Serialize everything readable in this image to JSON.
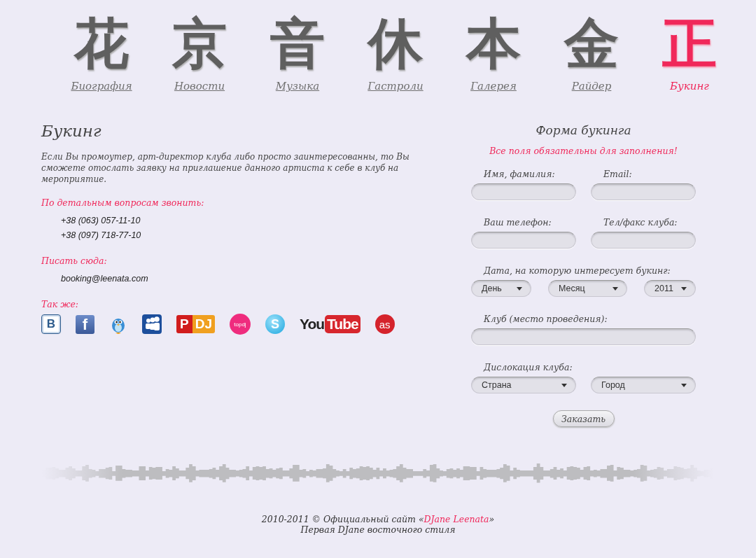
{
  "nav": [
    {
      "glyph": "花",
      "label": "Биография",
      "selected": false
    },
    {
      "glyph": "京",
      "label": "Новости",
      "selected": false
    },
    {
      "glyph": "音",
      "label": "Музыка",
      "selected": false
    },
    {
      "glyph": "休",
      "label": "Гастроли",
      "selected": false
    },
    {
      "glyph": "本",
      "label": "Галерея",
      "selected": false
    },
    {
      "glyph": "金",
      "label": "Райдер",
      "selected": false
    },
    {
      "glyph": "正",
      "label": "Букинг",
      "selected": true
    }
  ],
  "content": {
    "title": "Букинг",
    "intro": "Если Вы промоутер, арт-директор клуба либо просто заинтересованны, то Вы сможете отослать заявку на приглашение данного артиста к себе в клуб на мероприятие.",
    "sections": [
      {
        "heading": "По детальным  вопросам звонить:",
        "lines": [
          "+38 (063) 057-11-10",
          "+38 (097) 718-77-10"
        ]
      },
      {
        "heading": "Писать сюда:",
        "lines": [
          "booking@leenata.com"
        ]
      },
      {
        "heading": "Так же:"
      }
    ],
    "social": [
      {
        "kind": "vk",
        "text": [
          "В"
        ]
      },
      {
        "kind": "facebook",
        "text": [
          "f"
        ]
      },
      {
        "kind": "twitter"
      },
      {
        "kind": "myspace"
      },
      {
        "kind": "pdj",
        "text": [
          "P",
          "DJ"
        ]
      },
      {
        "kind": "topdj",
        "text": [
          "topdj"
        ]
      },
      {
        "kind": "skype",
        "text": [
          "S"
        ]
      },
      {
        "kind": "youtube",
        "text": [
          "You",
          "Tube"
        ]
      },
      {
        "kind": "lastfm",
        "text": [
          "as"
        ]
      }
    ]
  },
  "form": {
    "title": "Форма букинга",
    "note": "Все поля обязательны для заполнения!",
    "button": "Заказать",
    "rows": [
      {
        "fields": [
          {
            "kind": "text",
            "label": "Имя, фамилия:"
          },
          {
            "kind": "text",
            "label": "Email:"
          }
        ]
      },
      {
        "fields": [
          {
            "kind": "text",
            "label": "Ваш телефон:"
          },
          {
            "kind": "text",
            "label": "Тел/факс клуба:"
          }
        ]
      },
      {
        "label": "Дата, на которую интересует букинг:",
        "fields": [
          {
            "kind": "select",
            "value": "День"
          },
          {
            "kind": "select",
            "value": "Месяц"
          },
          {
            "kind": "select",
            "value": "2011"
          }
        ]
      },
      {
        "label": "Клуб (место проведения):",
        "fields": [
          {
            "kind": "text"
          }
        ]
      },
      {
        "label": "Дислокация клуба:",
        "fields": [
          {
            "kind": "select",
            "value": "Страна"
          },
          {
            "kind": "select",
            "value": "Город"
          }
        ]
      }
    ]
  },
  "footer": {
    "before": "2010-2011 © Официальный сайт «",
    "link": "DJane Leenata",
    "after": "»",
    "tagline": "Первая DJane восточного стиля"
  }
}
